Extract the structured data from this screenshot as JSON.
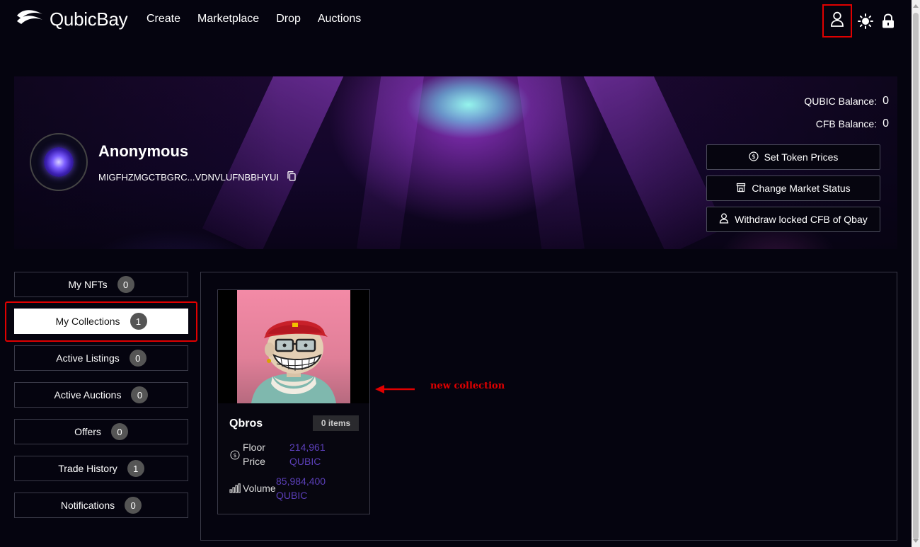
{
  "header": {
    "brand": "QubicBay",
    "nav": [
      "Create",
      "Marketplace",
      "Drop",
      "Auctions"
    ]
  },
  "profile": {
    "name": "Anonymous",
    "address": "MIGFHZMGCTBGRC...VDNVLUFNBBHYUI",
    "qubic_balance_label": "QUBIC Balance:",
    "qubic_balance_value": "0",
    "cfb_balance_label": "CFB Balance:",
    "cfb_balance_value": "0",
    "actions": {
      "set_token_prices": "Set Token Prices",
      "change_market_status": "Change Market Status",
      "withdraw_locked": "Withdraw locked CFB of Qbay"
    }
  },
  "sidebar": {
    "items": [
      {
        "label": "My NFTs",
        "count": "0"
      },
      {
        "label": "My Collections",
        "count": "1"
      },
      {
        "label": "Active Listings",
        "count": "0"
      },
      {
        "label": "Active Auctions",
        "count": "0"
      },
      {
        "label": "Offers",
        "count": "0"
      },
      {
        "label": "Trade History",
        "count": "1"
      },
      {
        "label": "Notifications",
        "count": "0"
      }
    ],
    "active": "My Collections"
  },
  "collection": {
    "name": "Qbros",
    "items": "0 items",
    "floor_label_1": "Floor",
    "floor_label_2": "Price",
    "floor_value_1": "214,961",
    "floor_value_2": "QUBIC",
    "volume_label": "Volume",
    "volume_value_1": "85,984,400",
    "volume_value_2": "QUBIC"
  },
  "annotation": {
    "text": "new collection",
    "color": "#e00000"
  },
  "colors": {
    "background": "#05040f",
    "accent_value": "#5b3fb8",
    "highlight": "#e00000"
  }
}
